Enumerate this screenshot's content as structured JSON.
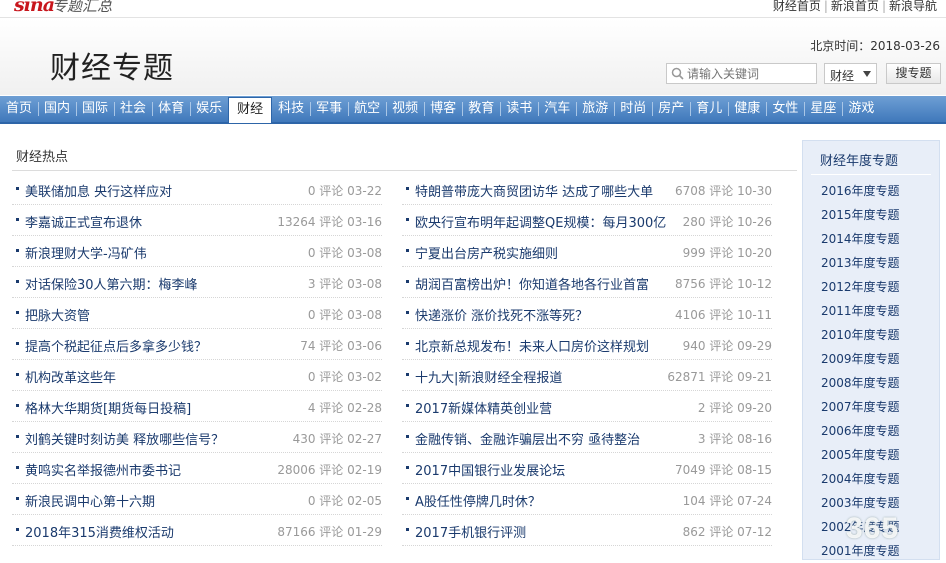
{
  "header": {
    "logo": "sina",
    "logo_sub": "专题汇总",
    "links": [
      "财经首页",
      "新浪首页",
      "新浪导航"
    ],
    "datetime": "北京时间：2018-03-26",
    "page_title": "财经专题"
  },
  "search": {
    "placeholder": "请输入关键词",
    "category": "财经",
    "button": "搜专题"
  },
  "nav": {
    "items": [
      "首页",
      "国内",
      "国际",
      "社会",
      "体育",
      "娱乐",
      "财经",
      "科技",
      "军事",
      "航空",
      "视频",
      "博客",
      "教育",
      "读书",
      "汽车",
      "旅游",
      "时尚",
      "房产",
      "育儿",
      "健康",
      "女性",
      "星座",
      "游戏"
    ],
    "active": "财经"
  },
  "main": {
    "section_title": "财经热点",
    "left": [
      {
        "title": "美联储加息 央行这样应对",
        "meta": "0 评论 03-22"
      },
      {
        "title": "李嘉诚正式宣布退休",
        "meta": "13264 评论 03-16"
      },
      {
        "title": "新浪理财大学-冯矿伟",
        "meta": "0 评论 03-08"
      },
      {
        "title": "对话保险30人第六期：梅李峰",
        "meta": "3 评论 03-08"
      },
      {
        "title": "把脉大资管",
        "meta": "0 评论 03-08"
      },
      {
        "title": "提高个税起征点后多拿多少钱？",
        "meta": "74 评论 03-06"
      },
      {
        "title": "机构改革这些年",
        "meta": "0 评论 03-02"
      },
      {
        "title": "格林大华期货[期货每日投稿]",
        "meta": "4 评论 02-28"
      },
      {
        "title": "刘鹤关键时刻访美 释放哪些信号？",
        "meta": "430 评论 02-27"
      },
      {
        "title": "黄鸣实名举报德州市委书记",
        "meta": "28006 评论 02-19"
      },
      {
        "title": "新浪民调中心第十六期",
        "meta": "0 评论 02-05"
      },
      {
        "title": "2018年315消费维权活动",
        "meta": "87166 评论 01-29"
      }
    ],
    "right": [
      {
        "title": "特朗普带庞大商贸团访华 达成了哪些大单",
        "meta": "6708 评论 10-30"
      },
      {
        "title": "欧央行宣布明年起调整QE规模：每月300亿",
        "meta": "280 评论 10-26"
      },
      {
        "title": "宁夏出台房产税实施细则",
        "meta": "999 评论 10-20"
      },
      {
        "title": "胡润百富榜出炉！你知道各地各行业首富",
        "meta": "8756 评论 10-12"
      },
      {
        "title": "快递涨价 涨价找死不涨等死？",
        "meta": "4106 评论 10-11"
      },
      {
        "title": "北京新总规发布！未来人口房价这样规划",
        "meta": "940 评论 09-29"
      },
      {
        "title": "十九大|新浪财经全程报道",
        "meta": "62871 评论 09-21"
      },
      {
        "title": "2017新媒体精英创业营",
        "meta": "2 评论 09-20"
      },
      {
        "title": "金融传销、金融诈骗层出不穷 亟待整治",
        "meta": "3 评论 08-16"
      },
      {
        "title": "2017中国银行业发展论坛",
        "meta": "7049 评论 08-15"
      },
      {
        "title": "A股任性停牌几时休？",
        "meta": "104 评论 07-24"
      },
      {
        "title": "2017手机银行评测",
        "meta": "862 评论 07-12"
      }
    ]
  },
  "sidebar": {
    "title": "财经年度专题",
    "links": [
      "2016年度专题",
      "2015年度专题",
      "2014年度专题",
      "2013年度专题",
      "2012年度专题",
      "2011年度专题",
      "2010年度专题",
      "2009年度专题",
      "2008年度专题",
      "2007年度专题",
      "2006年度专题",
      "2005年度专题",
      "2004年度专题",
      "2003年度专题",
      "2002年度专题",
      "2001年度专题"
    ]
  },
  "watermark": "365",
  "colors": {
    "nav_gradient_top": "#6e9fd4",
    "nav_gradient_bottom": "#3f78bb",
    "link": "#1a3a6d",
    "meta": "#999999",
    "logo_red": "#c8161d",
    "sidebar_bg": "#e8eef8"
  }
}
